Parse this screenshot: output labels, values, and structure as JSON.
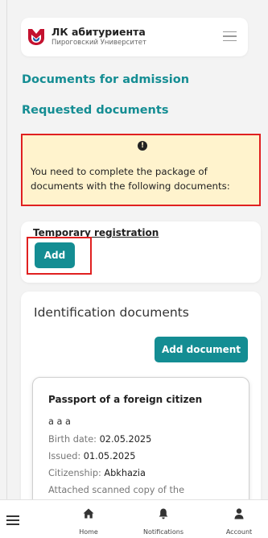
{
  "header": {
    "brand_title": "ЛК абитуриента",
    "brand_subtitle": "Пироговский Университет",
    "logo_color": "#c4122f",
    "accent_color": "#148d93"
  },
  "page": {
    "title": "Documents for admission",
    "section_title": "Requested documents"
  },
  "alert": {
    "icon": "exclamation-circle-icon",
    "message": "You need to complete the package of documents with the following documents:"
  },
  "required_document": {
    "title": "Temporary registration",
    "add_label": "Add"
  },
  "identification": {
    "title": "Identification documents",
    "add_document_label": "Add document",
    "document": {
      "title": "Passport of a foreign citizen",
      "name": "а а а",
      "birth_date_label": "Birth date: ",
      "birth_date": "02.05.2025",
      "issued_label": "Issued: ",
      "issued": "01.05.2025",
      "citizenship_label": "Citizenship: ",
      "citizenship": "Abkhazia",
      "scan_note": "Attached scanned copy of the"
    }
  },
  "bottom_nav": {
    "menu_icon": "hamburger-icon",
    "home_label": "Home",
    "notifications_label": "Notifications",
    "account_label": "Account"
  }
}
